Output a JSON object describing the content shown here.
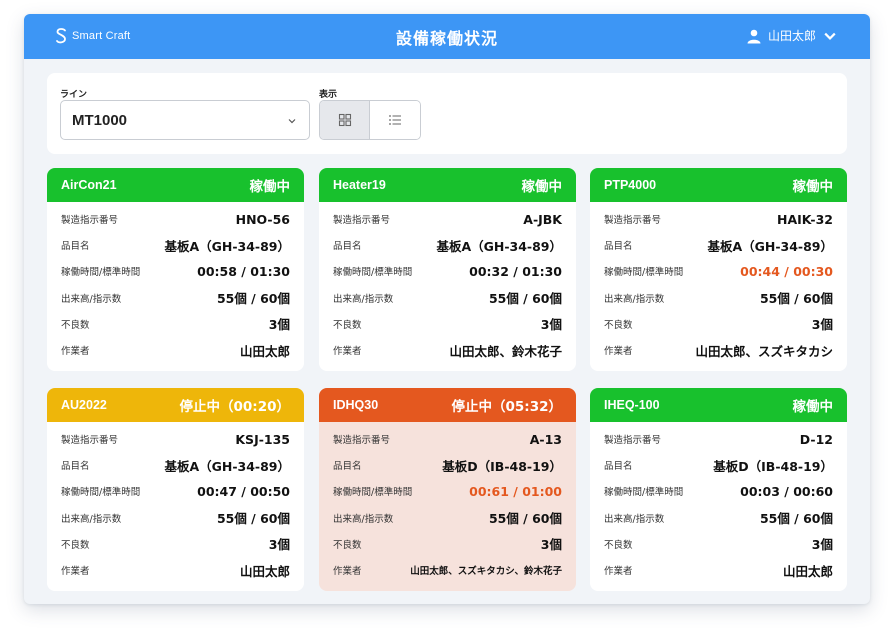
{
  "header": {
    "logo_text": "Smart Craft",
    "title": "設備稼働状況",
    "user_name": "山田太郎",
    "bar_color": "#3d96f5"
  },
  "filters": {
    "line_label": "ライン",
    "line_value": "MT1000",
    "view_label": "表示",
    "view_options": [
      "grid-view-icon",
      "list-view-icon"
    ],
    "view_selected": "grid-view-icon"
  },
  "row_labels": {
    "order": "製造指示番号",
    "product": "品目名",
    "time": "稼働時間/標準時間",
    "output": "出来高/指示数",
    "defects": "不良数",
    "worker": "作業者"
  },
  "status_colors": {
    "running": "#18c12d",
    "stopped_warning": "#eeb60a",
    "stopped_alert": "#e4581f"
  },
  "machines": [
    {
      "name": "AirCon21",
      "status": "稼働中",
      "order": "HNO-56",
      "product": "基板A（GH-34-89）",
      "time": "00:58 / 01:30",
      "output": "55個 / 60個",
      "defects": "3個",
      "worker": "山田太郎"
    },
    {
      "name": "Heater19",
      "status": "稼働中",
      "order": "A-JBK",
      "product": "基板A（GH-34-89）",
      "time": "00:32 / 01:30",
      "output": "55個 / 60個",
      "defects": "3個",
      "worker": "山田太郎、鈴木花子"
    },
    {
      "name": "PTP4000",
      "status": "稼働中",
      "order": "HAIK-32",
      "product": "基板A（GH-34-89）",
      "time": "00:44 / 00:30",
      "output": "55個 / 60個",
      "defects": "3個",
      "worker": "山田太郎、スズキタカシ"
    },
    {
      "name": "AU2022",
      "status": "停止中（00:20）",
      "order": "KSJ-135",
      "product": "基板A（GH-34-89）",
      "time": "00:47 / 00:50",
      "output": "55個 / 60個",
      "defects": "3個",
      "worker": "山田太郎"
    },
    {
      "name": "IDHQ30",
      "status": "停止中（05:32）",
      "order": "A-13",
      "product": "基板D（IB-48-19）",
      "time": "00:61 / 01:00",
      "output": "55個 / 60個",
      "defects": "3個",
      "worker": "山田太郎、スズキタカシ、鈴木花子"
    },
    {
      "name": "IHEQ-100",
      "status": "稼働中",
      "order": "D-12",
      "product": "基板D（IB-48-19）",
      "time": "00:03 / 00:60",
      "output": "55個 / 60個",
      "defects": "3個",
      "worker": "山田太郎"
    }
  ]
}
